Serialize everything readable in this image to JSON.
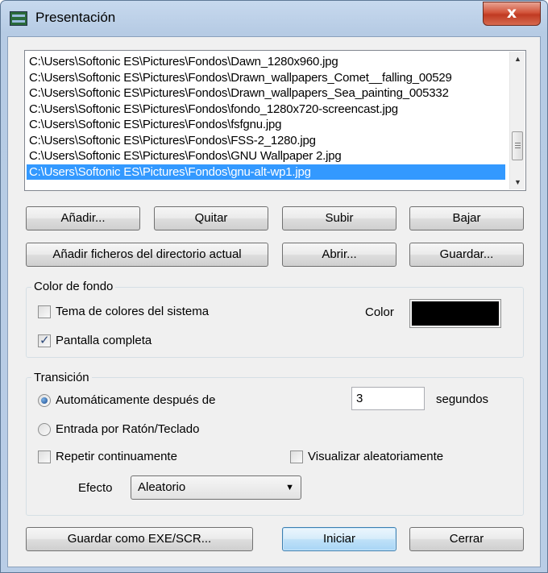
{
  "window": {
    "title": "Presentación",
    "close_label": "x"
  },
  "file_list": {
    "items": [
      "C:\\Users\\Softonic ES\\Pictures\\Fondos\\Dawn_1280x960.jpg",
      "C:\\Users\\Softonic ES\\Pictures\\Fondos\\Drawn_wallpapers_Comet__falling_00529",
      "C:\\Users\\Softonic ES\\Pictures\\Fondos\\Drawn_wallpapers_Sea_painting_005332",
      "C:\\Users\\Softonic ES\\Pictures\\Fondos\\fondo_1280x720-screencast.jpg",
      "C:\\Users\\Softonic ES\\Pictures\\Fondos\\fsfgnu.jpg",
      "C:\\Users\\Softonic ES\\Pictures\\Fondos\\FSS-2_1280.jpg",
      "C:\\Users\\Softonic ES\\Pictures\\Fondos\\GNU Wallpaper 2.jpg",
      "C:\\Users\\Softonic ES\\Pictures\\Fondos\\gnu-alt-wp1.jpg"
    ],
    "selected_index": 7,
    "scroll_up_icon": "triangle-up",
    "scroll_down_icon": "triangle-down"
  },
  "list_buttons": {
    "add": "Añadir...",
    "remove": "Quitar",
    "up": "Subir",
    "down": "Bajar",
    "add_dir": "Añadir ficheros del directorio actual",
    "open": "Abrir...",
    "save": "Guardar..."
  },
  "background": {
    "group_label": "Color de fondo",
    "system_theme_label": "Tema de colores del sistema",
    "system_theme_checked": false,
    "fullscreen_label": "Pantalla completa",
    "fullscreen_checked": true,
    "color_label": "Color",
    "color_value": "#000000"
  },
  "transition": {
    "group_label": "Transición",
    "auto_label": "Automáticamente después de",
    "auto_selected": true,
    "seconds_value": "3",
    "seconds_label": "segundos",
    "input_label": "Entrada por Ratón/Teclado",
    "input_selected": false,
    "repeat_label": "Repetir continuamente",
    "repeat_checked": false,
    "random_label": "Visualizar aleatoriamente",
    "random_checked": false,
    "effect_label": "Efecto",
    "effect_value": "Aleatorio"
  },
  "footer": {
    "save_exe": "Guardar como EXE/SCR...",
    "start": "Iniciar",
    "close": "Cerrar"
  },
  "colors": {
    "selection": "#3399ff",
    "title_gradient": "#c7d9ee",
    "close_button": "#c03a22"
  }
}
